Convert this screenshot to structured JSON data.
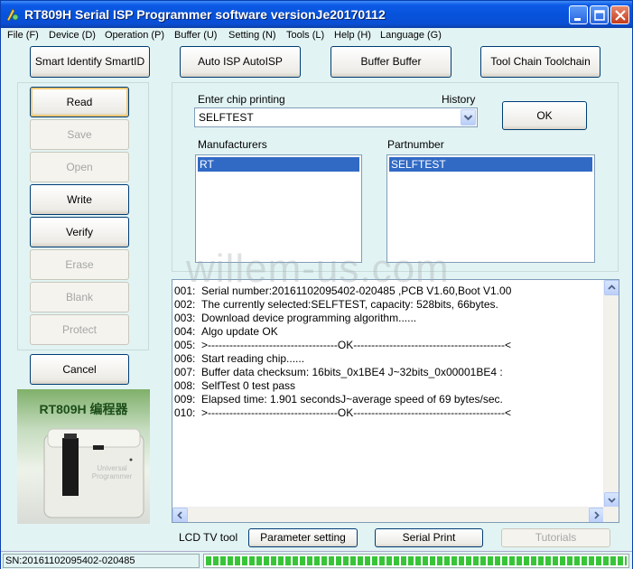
{
  "window": {
    "title": "RT809H Serial ISP Programmer software versionJe20170112"
  },
  "menu": [
    "File (F)",
    "Device (D)",
    "Operation (P)",
    "Buffer (U)",
    "Setting (N)",
    "Tools (L)",
    "Help (H)",
    "Language (G)"
  ],
  "toolbar": {
    "smart_identify": "Smart Identify SmartID",
    "auto_isp": "Auto ISP AutoISP",
    "buffer": "Buffer Buffer",
    "tool_chain": "Tool Chain Toolchain"
  },
  "sidebar": {
    "read": "Read",
    "save": "Save",
    "open": "Open",
    "write": "Write",
    "verify": "Verify",
    "erase": "Erase",
    "blank": "Blank",
    "protect": "Protect",
    "cancel": "Cancel"
  },
  "chip": {
    "enter_label": "Enter chip printing",
    "history_label": "History",
    "value": "SELFTEST",
    "ok": "OK",
    "manufacturers_label": "Manufacturers",
    "partnumber_label": "Partnumber",
    "manufacturer_selected": "RT",
    "partnumber_selected": "SELFTEST"
  },
  "log": [
    {
      "num": "001:",
      "text": "Serial number:20161102095402-020485 ,PCB V1.60,Boot V1.00"
    },
    {
      "num": "002:",
      "text": "The currently selected:SELFTEST, capacity: 528bits, 66bytes."
    },
    {
      "num": "003:",
      "text": "Download device programming algorithm......"
    },
    {
      "num": "004:",
      "text": "Algo update OK"
    },
    {
      "num": "005:",
      "text": ">------------------------------------OK------------------------------------------<"
    },
    {
      "num": "006:",
      "text": "Start reading chip......"
    },
    {
      "num": "007:",
      "text": "Buffer data checksum: 16bits_0x1BE4 J~32bits_0x00001BE4 :"
    },
    {
      "num": "008:",
      "text": "SelfTest 0 test pass"
    },
    {
      "num": "009:",
      "text": "Elapsed time: 1.901 secondsJ~average speed of 69 bytes/sec."
    },
    {
      "num": "010:",
      "text": ">------------------------------------OK------------------------------------------<"
    }
  ],
  "watermark": "willem-us.com",
  "device_image": {
    "title": "RT809H 编程器",
    "body_text": "Universal Programmer"
  },
  "bottom": {
    "lcd_label": "LCD TV tool",
    "parameter_setting": "Parameter setting",
    "serial_print": "Serial Print",
    "tutorials": "Tutorials"
  },
  "status": {
    "serial": "SN:20161102095402-020485",
    "progress_fraction": 1.0
  },
  "colors": {
    "window_bg": "#e2f3f3",
    "title_blue": "#0653dc",
    "selection": "#316ac5",
    "progress_green": "#37c537"
  }
}
